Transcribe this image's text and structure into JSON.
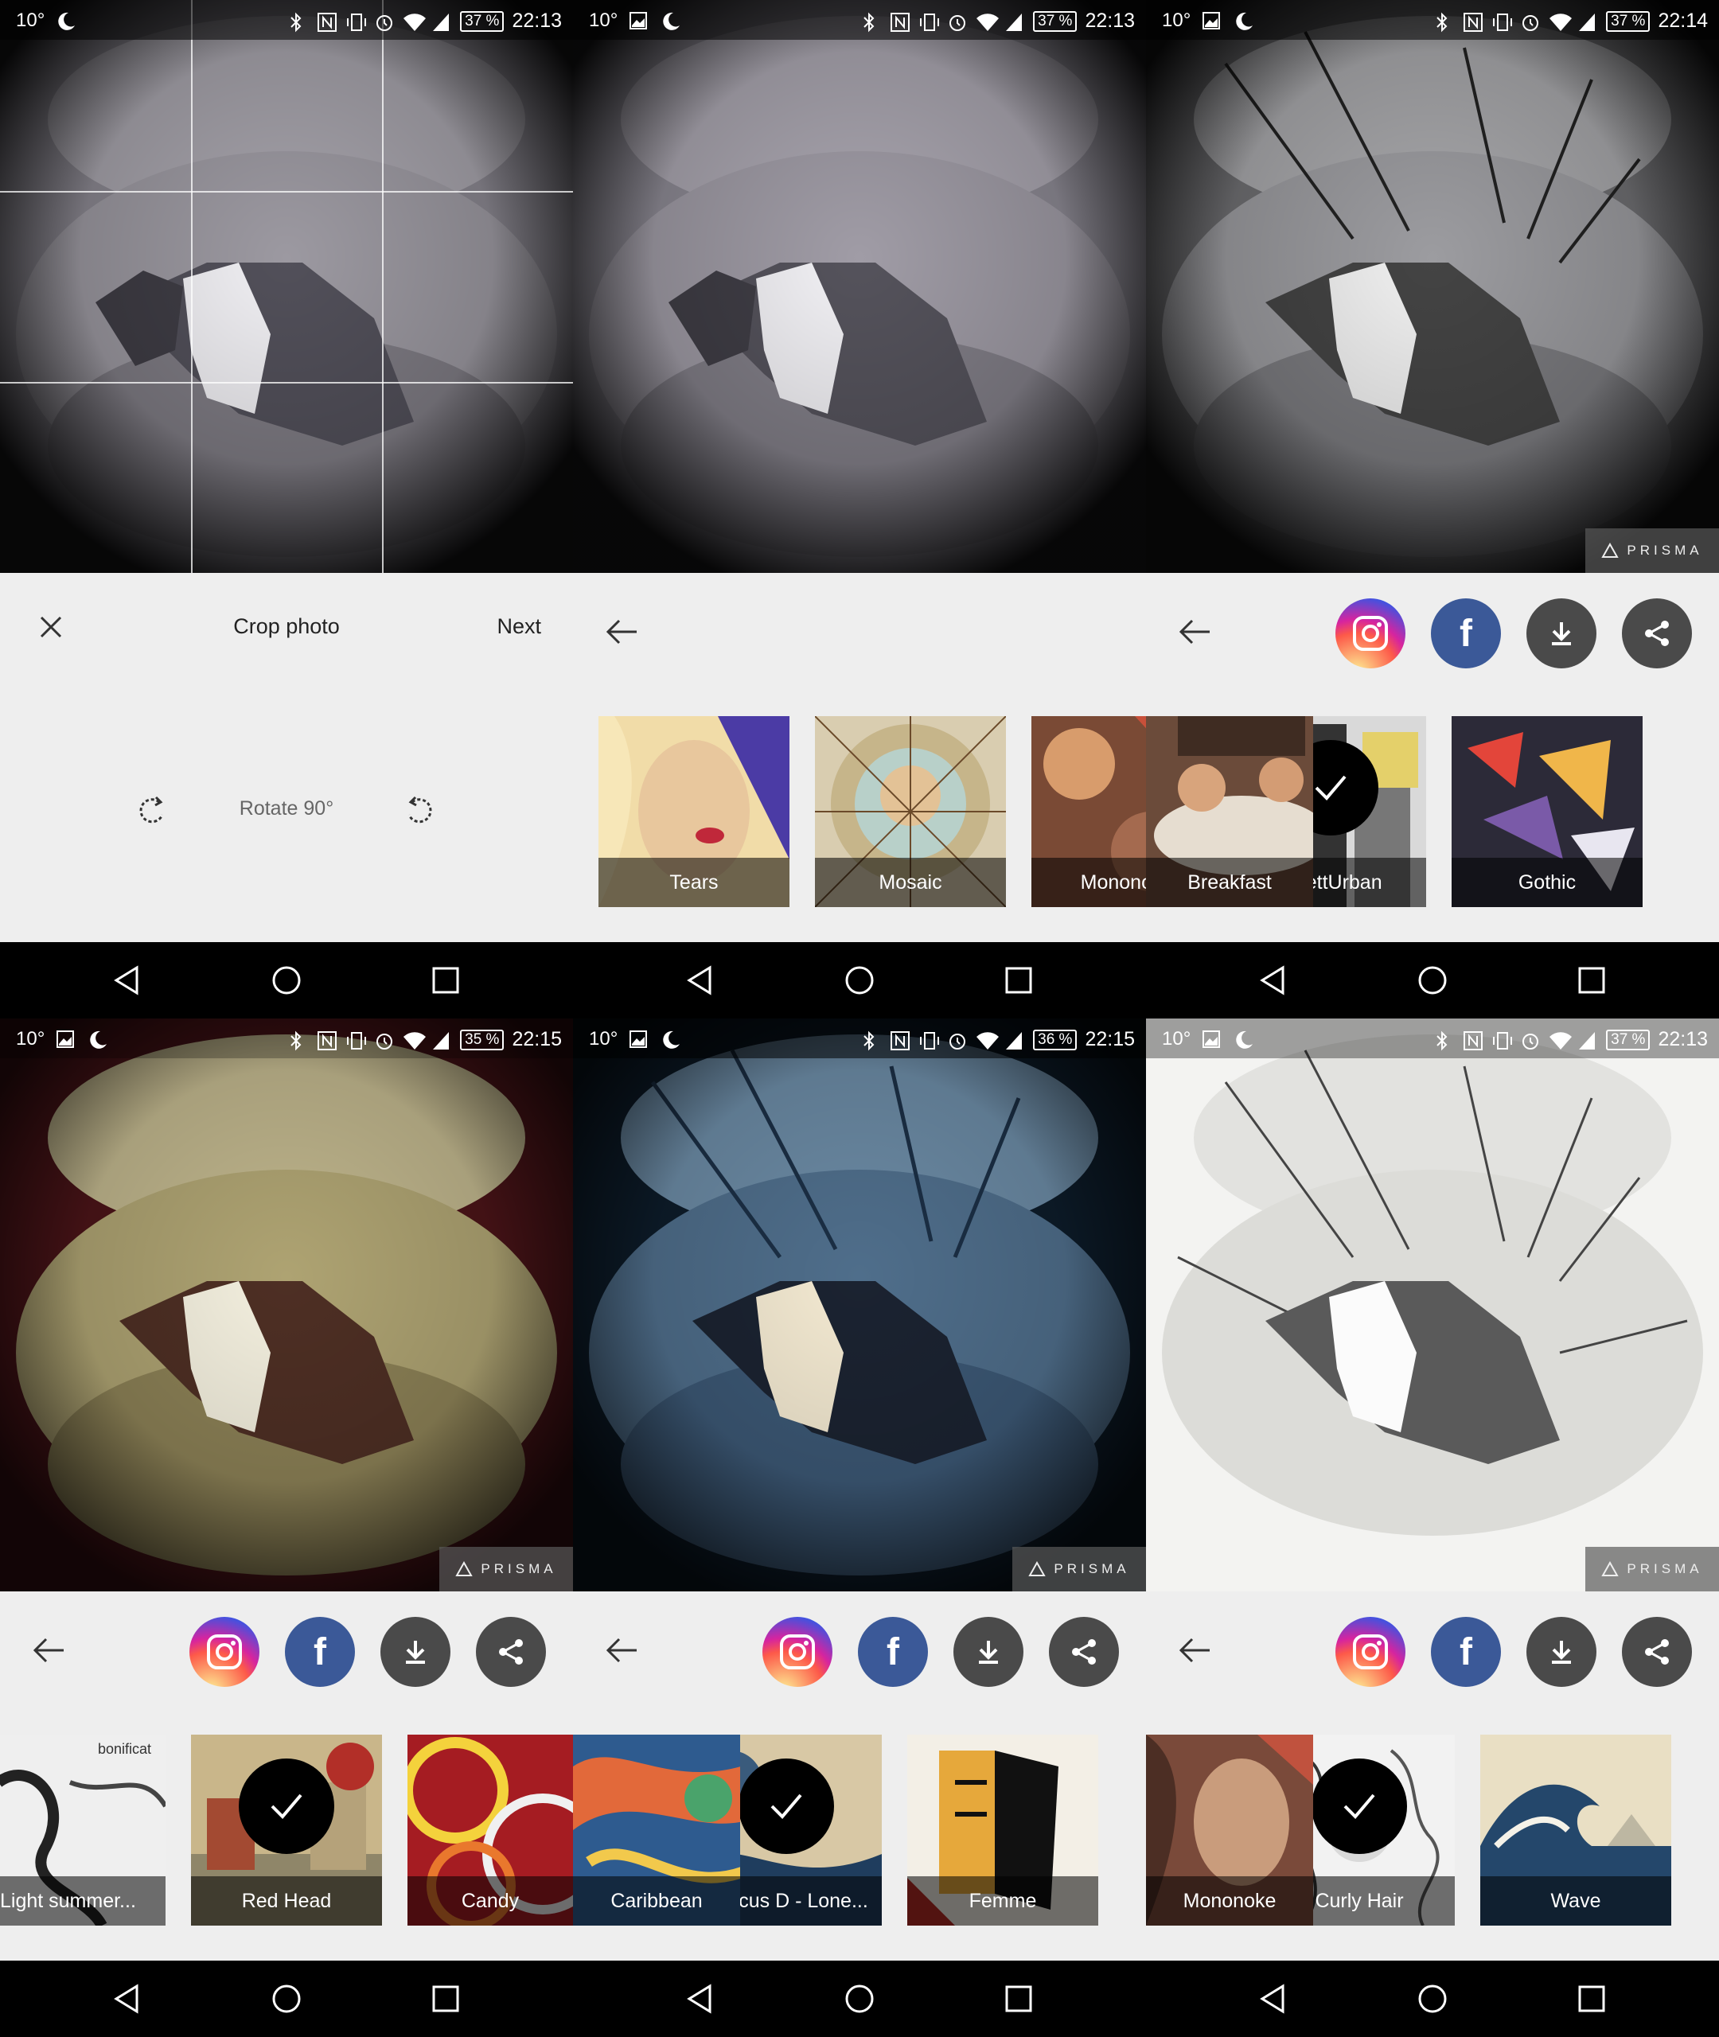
{
  "panels": [
    {
      "status": {
        "temp": "10°",
        "battery": "37 %",
        "time": "22:13"
      },
      "crop": {
        "close_icon": "close-icon",
        "title": "Crop photo",
        "next_label": "Next",
        "rotate_label": "Rotate 90°"
      }
    },
    {
      "status": {
        "temp": "10°",
        "battery": "37 %",
        "time": "22:13"
      },
      "filters": [
        "Tears",
        "Mosaic",
        "Mononoke",
        "Breakfast",
        "#GettUrban",
        "Gothic"
      ],
      "selected": "#GettUrban"
    },
    {
      "status": {
        "temp": "10°",
        "battery": "37 %",
        "time": "22:14"
      },
      "watermark": "PRISMA",
      "share": [
        "instagram-icon",
        "facebook-icon",
        "download-icon",
        "share-icon"
      ],
      "facebook_glyph": "f"
    },
    {
      "status": {
        "temp": "10°",
        "battery": "35 %",
        "time": "22:15"
      },
      "watermark": "PRISMA",
      "filters": [
        "Light summer...",
        "Red Head",
        "Candy",
        "Caribbean"
      ],
      "tile_caption": "bonificat",
      "selected": "Red Head",
      "facebook_glyph": "f"
    },
    {
      "status": {
        "temp": "10°",
        "battery": "36 %",
        "time": "22:15"
      },
      "watermark": "PRISMA",
      "filters": [
        "Marcus D - Lone...",
        "Femme",
        "Mononoke"
      ],
      "selected": "Marcus D - Lone...",
      "facebook_glyph": "f"
    },
    {
      "status": {
        "temp": "10°",
        "battery": "37 %",
        "time": "22:13"
      },
      "watermark": "PRISMA",
      "filters": [
        "Curly Hair",
        "Wave"
      ],
      "selected": "Curly Hair",
      "facebook_glyph": "f"
    }
  ],
  "colors": {
    "toolbar_bg": "#eeeeee",
    "facebook": "#3b5998",
    "dark_button": "#4a4a4a",
    "nav_bg": "#000000"
  }
}
